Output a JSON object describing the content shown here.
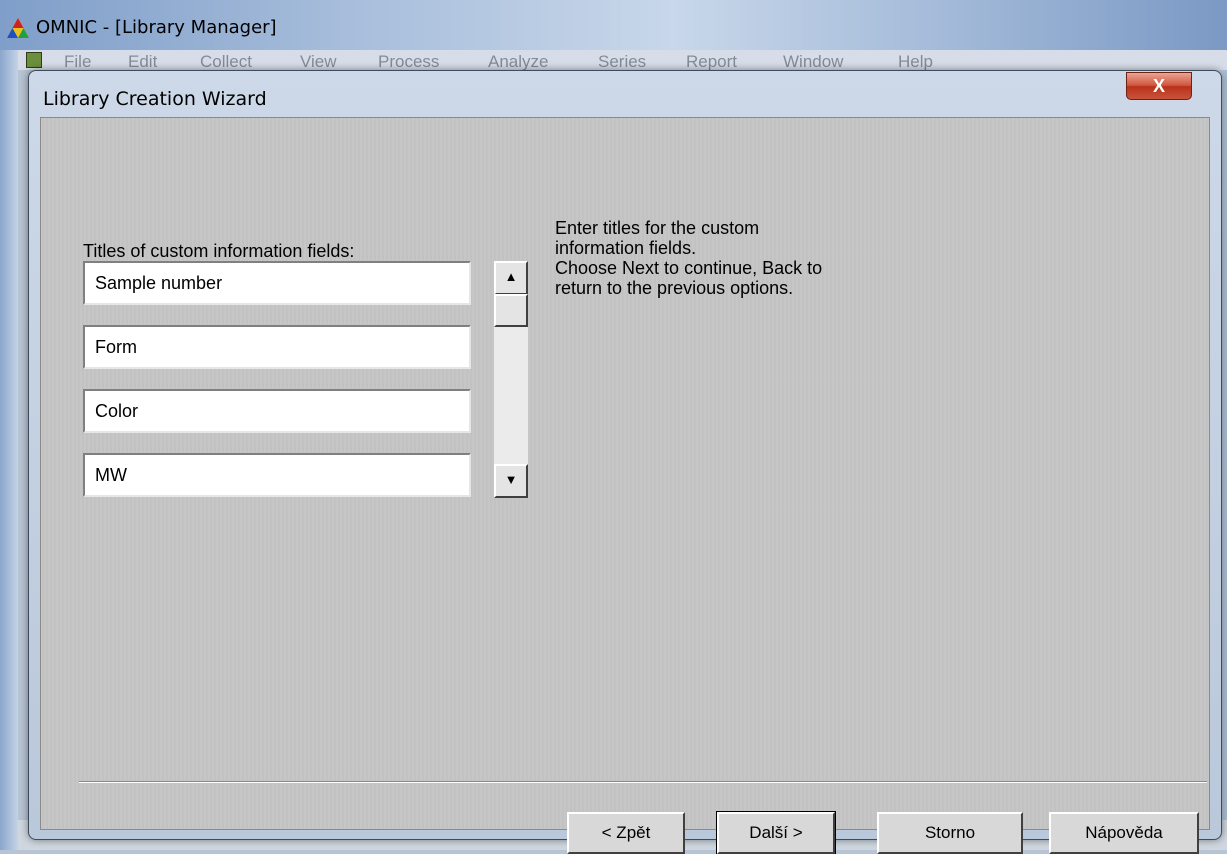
{
  "app": {
    "title": "OMNIC - [Library Manager]",
    "menu": [
      "File",
      "Edit",
      "Collect",
      "View",
      "Process",
      "Analyze",
      "Series",
      "Report",
      "Window",
      "Help"
    ]
  },
  "dialog": {
    "title": "Library Creation Wizard",
    "close_label": "X",
    "fields_caption": "Titles of custom information fields:",
    "fields": [
      "Sample number",
      "Form",
      "Color",
      "MW"
    ],
    "instructions": [
      "Enter titles for the custom",
      "information fields.",
      "Choose Next to continue, Back to",
      "return to the previous options."
    ],
    "buttons": {
      "back": "< Zpět",
      "next": "Další >",
      "cancel": "Storno",
      "help": "Nápověda"
    }
  },
  "icons": {
    "app_logo": "omnic-triangle-icon",
    "scroll_up": "scroll-up-arrow-icon",
    "scroll_down": "scroll-down-arrow-icon"
  },
  "colors": {
    "dialog_frame": "#cdd9e8",
    "close_button": "#c9533a",
    "client_area": "#c6c6c6"
  }
}
